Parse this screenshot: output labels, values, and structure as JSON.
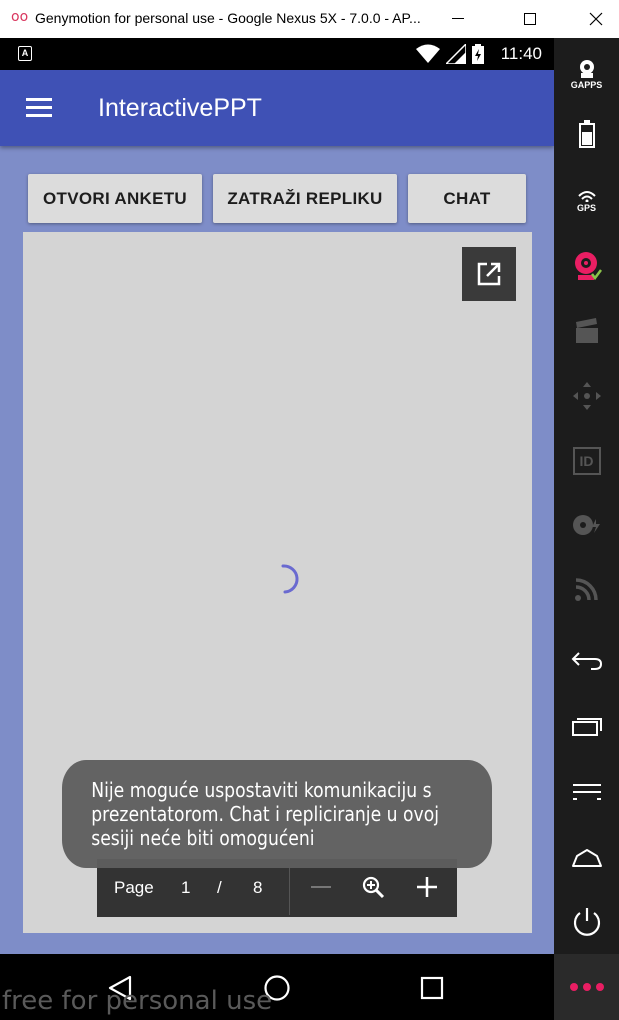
{
  "window": {
    "title": "Genymotion for personal use - Google Nexus 5X - 7.0.0 - AP..."
  },
  "status_bar": {
    "notification_icon": "A",
    "time": "11:40"
  },
  "app_bar": {
    "title": "InteractivePPT"
  },
  "actions": {
    "open_survey": "OTVORI ANKETU",
    "request_reply": "ZATRAŽI REPLIKU",
    "chat": "CHAT"
  },
  "viewer": {
    "page_label": "Page",
    "current_page": "1",
    "separator": "/",
    "total_pages": "8"
  },
  "toast": {
    "message": "Nije moguće uspostaviti komunikaciju s prezentatorom. Chat i repliciranje u ovoj sesiji neće biti omogućeni"
  },
  "sidebar": {
    "gapps_label": "GAPPS",
    "gps_label": "GPS",
    "id_label": "ID"
  },
  "watermark": "free for personal use",
  "colors": {
    "app_bar": "#3f51b5",
    "background": "#7e8dc8",
    "accent": "#e91e63"
  }
}
